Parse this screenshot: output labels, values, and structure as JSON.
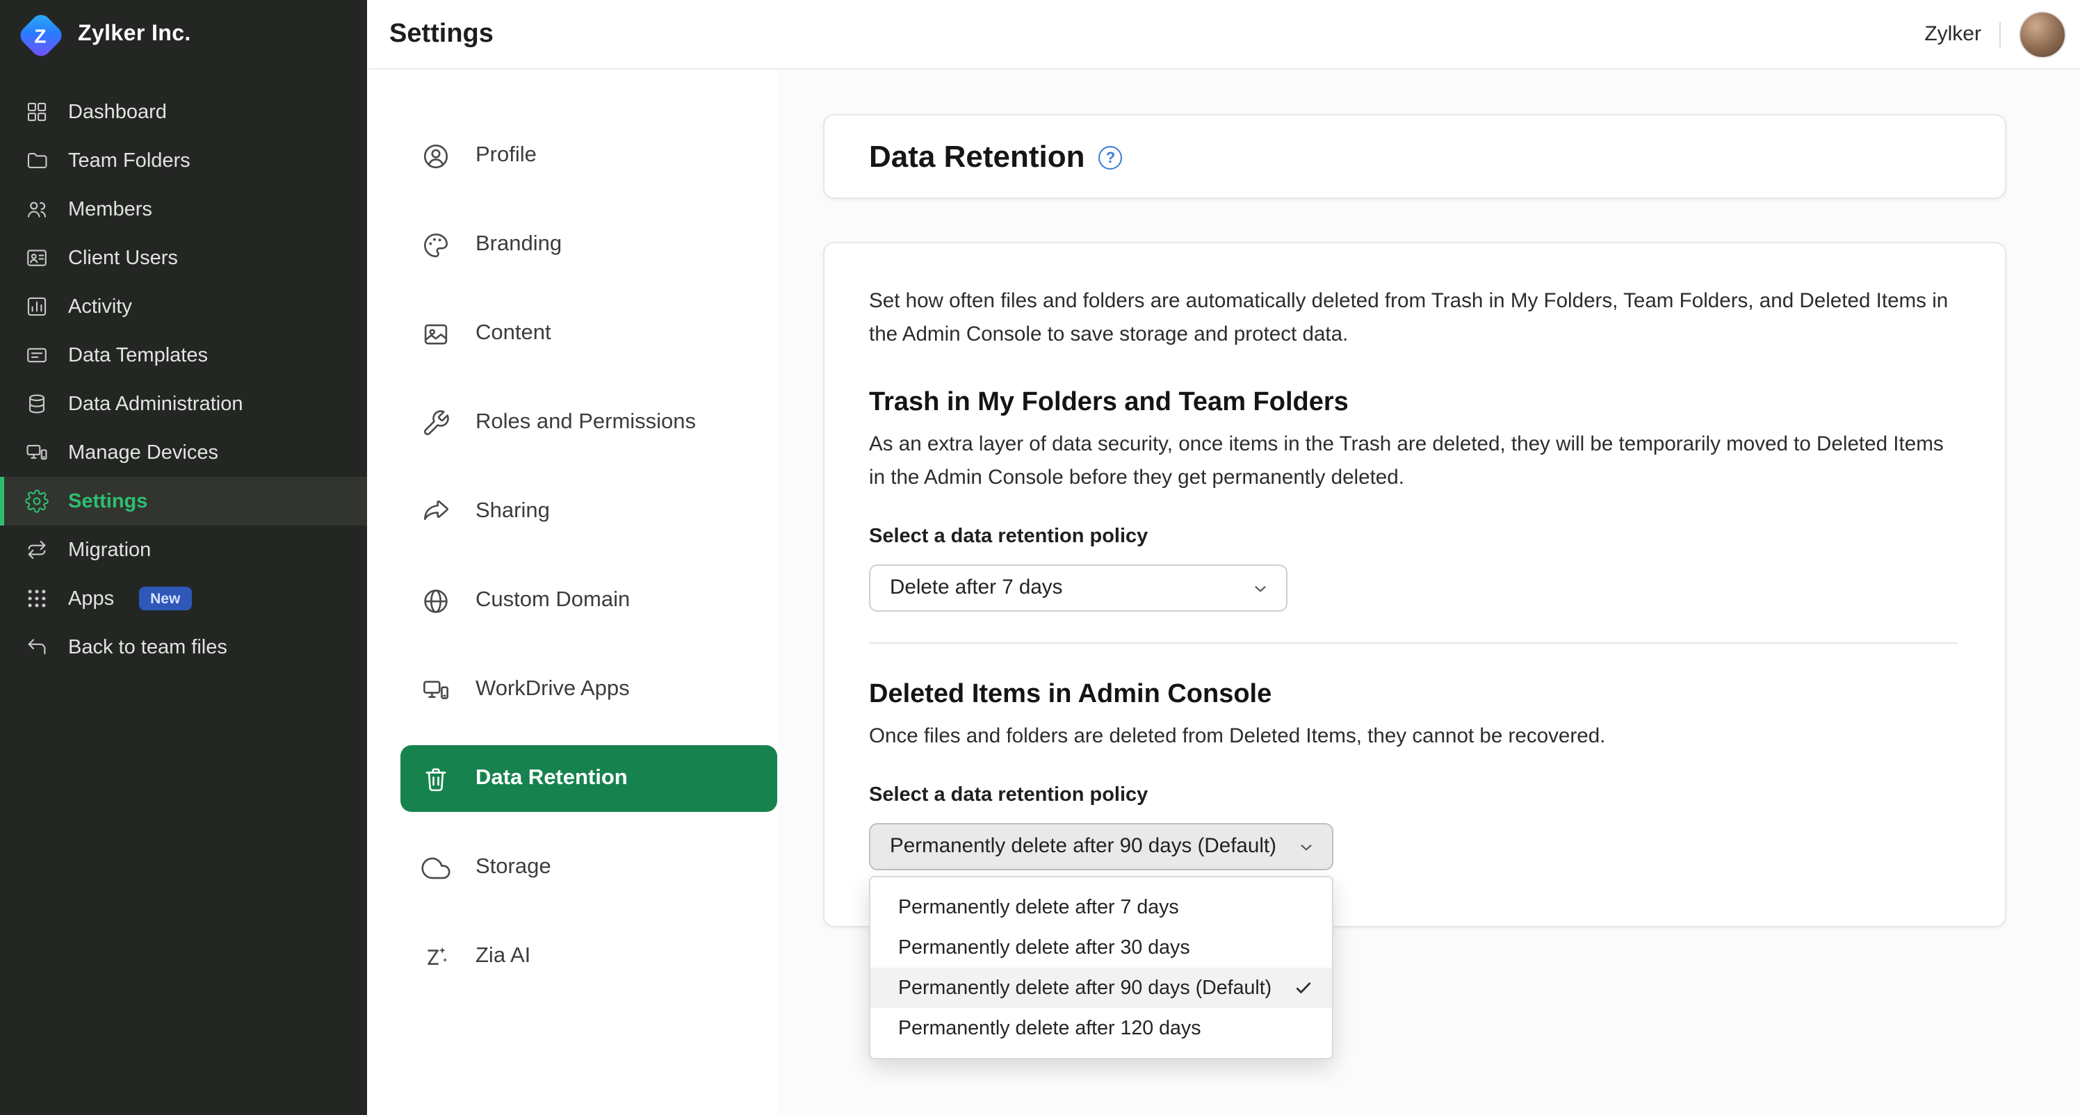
{
  "brand": {
    "name": "Zylker Inc.",
    "logo_letter": "Z"
  },
  "topbar": {
    "title": "Settings",
    "account_name": "Zylker"
  },
  "sidebar": {
    "items": [
      {
        "label": "Dashboard",
        "icon": "dashboard-grid-icon"
      },
      {
        "label": "Team Folders",
        "icon": "team-folder-icon"
      },
      {
        "label": "Members",
        "icon": "members-icon"
      },
      {
        "label": "Client Users",
        "icon": "client-users-icon"
      },
      {
        "label": "Activity",
        "icon": "activity-icon"
      },
      {
        "label": "Data Templates",
        "icon": "data-templates-icon"
      },
      {
        "label": "Data Administration",
        "icon": "data-administration-icon"
      },
      {
        "label": "Manage Devices",
        "icon": "manage-devices-icon"
      },
      {
        "label": "Settings",
        "icon": "gear-icon",
        "active": true
      },
      {
        "label": "Migration",
        "icon": "migration-icon"
      },
      {
        "label": "Apps",
        "icon": "apps-grid-icon",
        "badge": "New"
      },
      {
        "label": "Back to team files",
        "icon": "return-icon"
      }
    ]
  },
  "settings_nav": {
    "items": [
      {
        "label": "Profile",
        "icon": "profile-icon"
      },
      {
        "label": "Branding",
        "icon": "palette-icon"
      },
      {
        "label": "Content",
        "icon": "content-image-icon"
      },
      {
        "label": "Roles and Permissions",
        "icon": "wrench-icon"
      },
      {
        "label": "Sharing",
        "icon": "share-icon"
      },
      {
        "label": "Custom Domain",
        "icon": "globe-icon"
      },
      {
        "label": "WorkDrive Apps",
        "icon": "workdrive-apps-icon"
      },
      {
        "label": "Data Retention",
        "icon": "trash-icon",
        "active": true
      },
      {
        "label": "Storage",
        "icon": "cloud-icon"
      },
      {
        "label": "Zia AI",
        "icon": "zia-ai-icon"
      }
    ]
  },
  "main": {
    "page_title": "Data Retention",
    "help_icon_glyph": "?",
    "intro": "Set how often files and folders are automatically deleted from Trash in My Folders, Team Folders, and Deleted Items in the Admin Console to save storage and protect data.",
    "trash_section": {
      "heading": "Trash in My Folders and Team Folders",
      "description": "As an extra layer of data security, once items in the Trash are deleted, they will be temporarily moved to Deleted Items in the Admin Console before they get permanently deleted.",
      "policy_label": "Select a data retention policy",
      "selected_policy": "Delete after 7 days"
    },
    "deleted_items_section": {
      "heading": "Deleted Items in Admin Console",
      "description": "Once files and folders are deleted from Deleted Items, they cannot be recovered.",
      "policy_label": "Select a data retention policy",
      "selected_policy": "Permanently delete after 90 days (Default)",
      "dropdown_options": [
        {
          "label": "Permanently delete after 7 days",
          "selected": false
        },
        {
          "label": "Permanently delete after 30 days",
          "selected": false
        },
        {
          "label": "Permanently delete after 90 days (Default)",
          "selected": true
        },
        {
          "label": "Permanently delete after 120 days",
          "selected": false
        }
      ]
    }
  },
  "colors": {
    "accent_green": "#16834e",
    "sidebar_active_green": "#2fbe70",
    "badge_blue": "#2e57b8",
    "help_blue": "#3a7bd5"
  }
}
